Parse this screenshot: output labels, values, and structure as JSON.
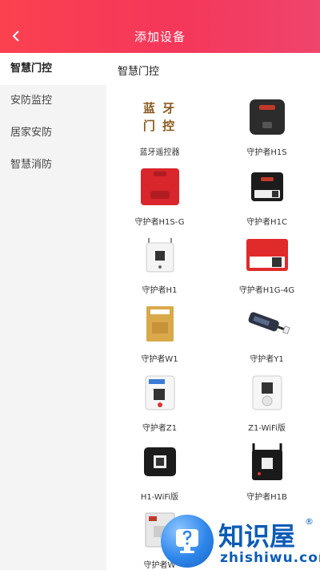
{
  "header": {
    "title": "添加设备",
    "back_icon": "chevron-left-icon"
  },
  "sidebar": {
    "items": [
      {
        "label": "智慧门控",
        "active": true
      },
      {
        "label": "安防监控",
        "active": false
      },
      {
        "label": "居家安防",
        "active": false
      },
      {
        "label": "智慧消防",
        "active": false
      }
    ]
  },
  "main": {
    "section_title": "智慧门控",
    "devices": [
      {
        "label": "蓝牙遥控器",
        "image_text": "蓝 牙\n门 控"
      },
      {
        "label": "守护者H1S"
      },
      {
        "label": "守护者H1S-G"
      },
      {
        "label": "守护者H1C"
      },
      {
        "label": "守护者H1"
      },
      {
        "label": "守护者H1G-4G"
      },
      {
        "label": "守护者W1"
      },
      {
        "label": "守护者Y1"
      },
      {
        "label": "守护者Z1"
      },
      {
        "label": "Z1-WiFi版"
      },
      {
        "label": "H1-WiFi版"
      },
      {
        "label": "守护者H1B"
      },
      {
        "label": "守护者W"
      }
    ]
  },
  "watermark": {
    "brand": "知识屋",
    "domain": "zhishiwu.com",
    "reg": "®"
  },
  "colors": {
    "accent": "#f4375a",
    "watermark": "#0d5cb6"
  }
}
